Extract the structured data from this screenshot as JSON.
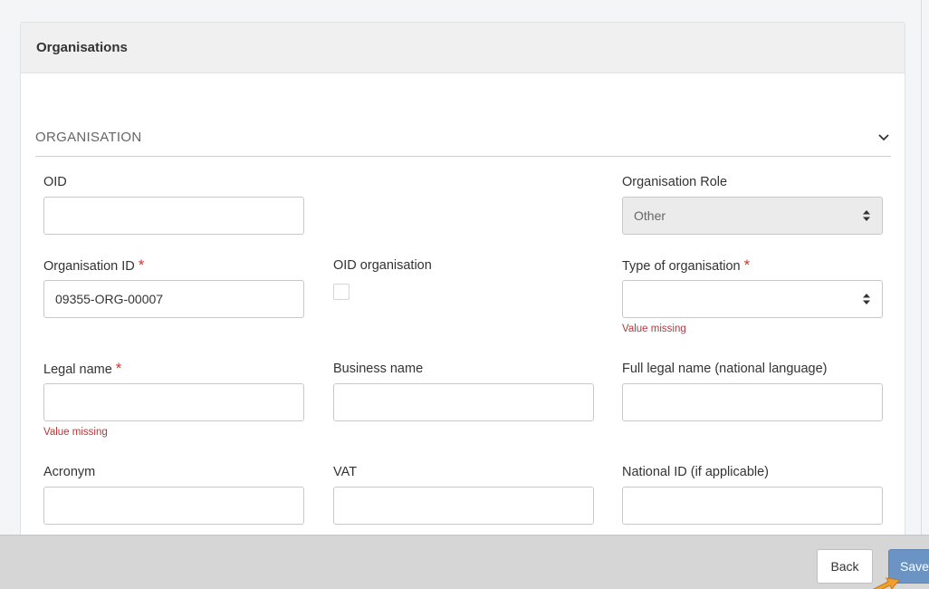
{
  "card": {
    "title": "Organisations"
  },
  "section": {
    "title": "ORGANISATION",
    "toggle_icon": "chevron-down-icon"
  },
  "fields": {
    "oid": {
      "label": "OID",
      "value": ""
    },
    "org_role": {
      "label": "Organisation Role",
      "value": "Other"
    },
    "org_id": {
      "label": "Organisation ID",
      "required": "*",
      "value": "09355-ORG-00007"
    },
    "oid_org": {
      "label": "OID organisation",
      "checked": false
    },
    "org_type": {
      "label": "Type of organisation",
      "required": "*",
      "value": "",
      "error": "Value missing"
    },
    "legal_name": {
      "label": "Legal name",
      "required": "*",
      "value": "",
      "error": "Value missing"
    },
    "business_name": {
      "label": "Business name",
      "value": ""
    },
    "full_legal_name": {
      "label": "Full legal name (national language)",
      "value": ""
    },
    "acronym": {
      "label": "Acronym",
      "value": ""
    },
    "vat": {
      "label": "VAT",
      "value": ""
    },
    "national_id": {
      "label": "National ID (if applicable)",
      "value": ""
    }
  },
  "footer": {
    "back_label": "Back",
    "save_label": "Save"
  },
  "colors": {
    "required": "#d0342c",
    "error": "#b33a3a",
    "save": "#6b93c3",
    "cursor": "#f0a030"
  }
}
